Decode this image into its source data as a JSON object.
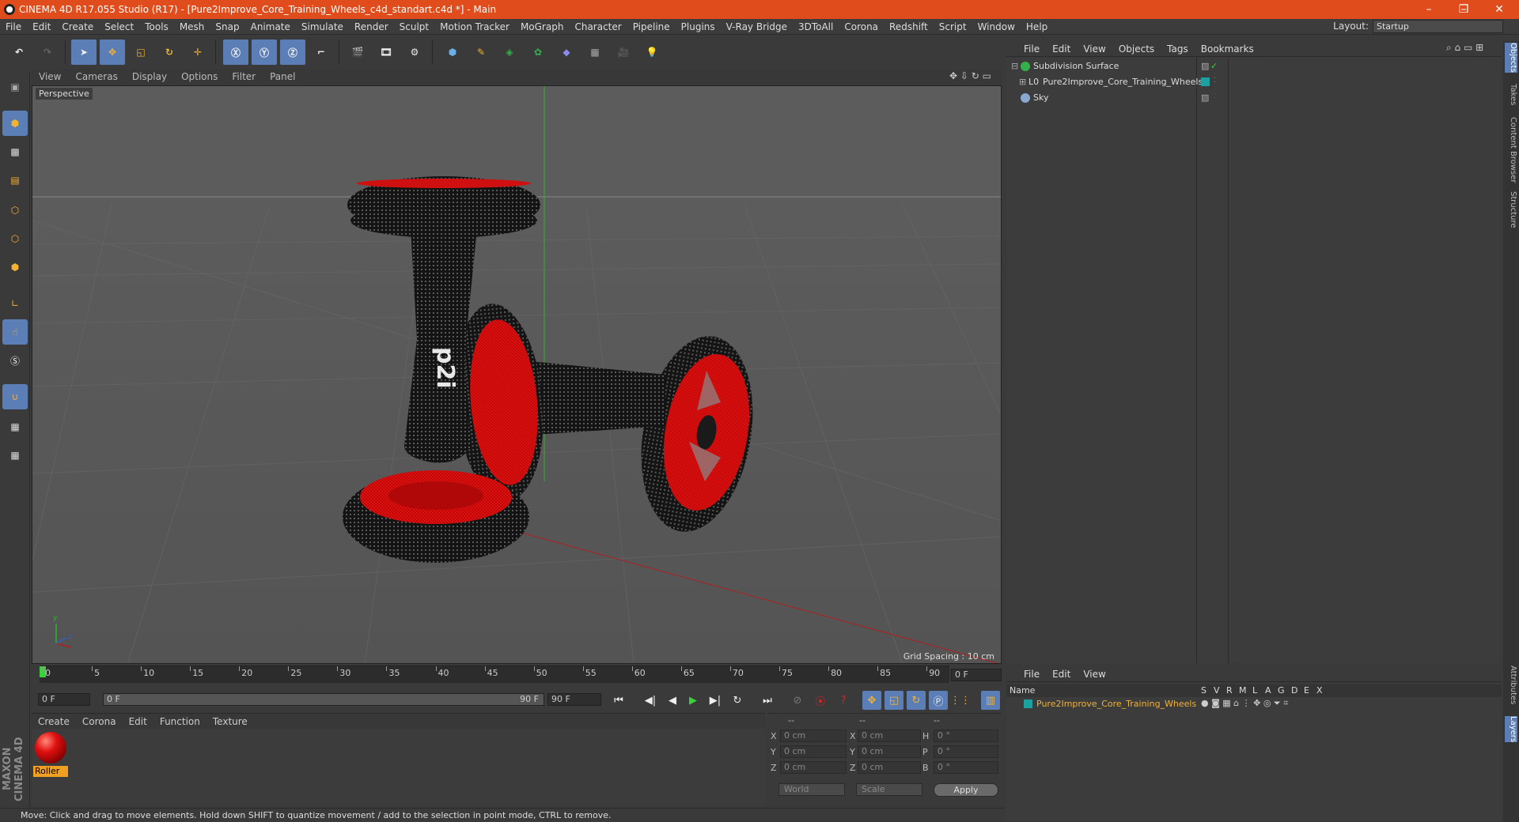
{
  "window": {
    "title": "CINEMA 4D R17.055 Studio (R17) - [Pure2Improve_Core_Training_Wheels_c4d_standart.c4d *] - Main",
    "minimize": "–",
    "maximize": "❐",
    "close": "✕"
  },
  "menubar": {
    "items": [
      "File",
      "Edit",
      "Create",
      "Select",
      "Tools",
      "Mesh",
      "Snap",
      "Animate",
      "Simulate",
      "Render",
      "Sculpt",
      "Motion Tracker",
      "MoGraph",
      "Character",
      "Pipeline",
      "Plugins",
      "V-Ray Bridge",
      "3DToAll",
      "Corona",
      "Redshift",
      "Script",
      "Window",
      "Help"
    ],
    "layout_label": "Layout:",
    "layout_value": "Startup"
  },
  "viewport": {
    "menu": [
      "View",
      "Cameras",
      "Display",
      "Options",
      "Filter",
      "Panel"
    ],
    "label": "Perspective",
    "grid_spacing": "Grid Spacing : 10 cm",
    "axis_y": "y",
    "axis_z": "z"
  },
  "timeline": {
    "ticks": [
      "0",
      "5",
      "10",
      "15",
      "20",
      "25",
      "30",
      "35",
      "40",
      "45",
      "50",
      "55",
      "60",
      "65",
      "70",
      "75",
      "80",
      "85",
      "90"
    ],
    "current_frame": "0 F",
    "start_field": "0 F",
    "range_start": "0 F",
    "range_end": "90 F",
    "end_field": "90 F"
  },
  "materials": {
    "menu": [
      "Create",
      "Corona",
      "Edit",
      "Function",
      "Texture"
    ],
    "items": [
      {
        "name": "Roller",
        "color": "#e01010"
      }
    ]
  },
  "coords": {
    "header": [
      "--",
      "--",
      "--"
    ],
    "rows": [
      {
        "a": "X",
        "a_val": "0 cm",
        "b": "X",
        "b_val": "0 cm",
        "c": "H",
        "c_val": "0 °"
      },
      {
        "a": "Y",
        "a_val": "0 cm",
        "b": "Y",
        "b_val": "0 cm",
        "c": "P",
        "c_val": "0 °"
      },
      {
        "a": "Z",
        "a_val": "0 cm",
        "b": "Z",
        "b_val": "0 cm",
        "c": "B",
        "c_val": "0 °"
      }
    ],
    "mode_select": "World",
    "scale_select": "Scale",
    "apply": "Apply"
  },
  "status": "Move: Click and drag to move elements. Hold down SHIFT to quantize movement / add to the selection in point mode, CTRL to remove.",
  "objects": {
    "menu": [
      "File",
      "Edit",
      "View",
      "Objects",
      "Tags",
      "Bookmarks"
    ],
    "items": [
      {
        "name": "Subdivision Surface",
        "icon_color": "#36b04a"
      },
      {
        "name": "Pure2Improve_Core_Training_Wheels",
        "icon_color": "#bbbbbb"
      },
      {
        "name": "Sky",
        "icon_color": "#8aa8d0"
      }
    ]
  },
  "layers": {
    "menu": [
      "File",
      "Edit",
      "View"
    ],
    "header": {
      "name": "Name",
      "cols": [
        "S",
        "V",
        "R",
        "M",
        "L",
        "A",
        "G",
        "D",
        "E",
        "X"
      ]
    },
    "rows": [
      {
        "name": "Pure2Improve_Core_Training_Wheels",
        "color": "#1fa0a0"
      }
    ]
  },
  "right_tabs": [
    "Objects",
    "Takes",
    "Content Browser",
    "Structure",
    "Attributes",
    "Layers"
  ],
  "brand": "MAXON CINEMA 4D",
  "colors": {
    "accent": "#5c7eb6",
    "titlebar": "#e04c1b",
    "wheel_red": "#e01010"
  }
}
